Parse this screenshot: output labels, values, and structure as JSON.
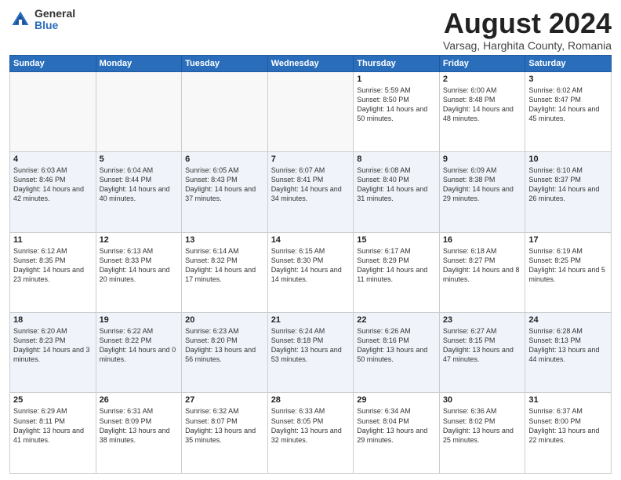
{
  "logo": {
    "general": "General",
    "blue": "Blue"
  },
  "header": {
    "month_year": "August 2024",
    "location": "Varsag, Harghita County, Romania"
  },
  "days_of_week": [
    "Sunday",
    "Monday",
    "Tuesday",
    "Wednesday",
    "Thursday",
    "Friday",
    "Saturday"
  ],
  "weeks": [
    [
      {
        "day": "",
        "info": ""
      },
      {
        "day": "",
        "info": ""
      },
      {
        "day": "",
        "info": ""
      },
      {
        "day": "",
        "info": ""
      },
      {
        "day": "1",
        "info": "Sunrise: 5:59 AM\nSunset: 8:50 PM\nDaylight: 14 hours and 50 minutes."
      },
      {
        "day": "2",
        "info": "Sunrise: 6:00 AM\nSunset: 8:48 PM\nDaylight: 14 hours and 48 minutes."
      },
      {
        "day": "3",
        "info": "Sunrise: 6:02 AM\nSunset: 8:47 PM\nDaylight: 14 hours and 45 minutes."
      }
    ],
    [
      {
        "day": "4",
        "info": "Sunrise: 6:03 AM\nSunset: 8:46 PM\nDaylight: 14 hours and 42 minutes."
      },
      {
        "day": "5",
        "info": "Sunrise: 6:04 AM\nSunset: 8:44 PM\nDaylight: 14 hours and 40 minutes."
      },
      {
        "day": "6",
        "info": "Sunrise: 6:05 AM\nSunset: 8:43 PM\nDaylight: 14 hours and 37 minutes."
      },
      {
        "day": "7",
        "info": "Sunrise: 6:07 AM\nSunset: 8:41 PM\nDaylight: 14 hours and 34 minutes."
      },
      {
        "day": "8",
        "info": "Sunrise: 6:08 AM\nSunset: 8:40 PM\nDaylight: 14 hours and 31 minutes."
      },
      {
        "day": "9",
        "info": "Sunrise: 6:09 AM\nSunset: 8:38 PM\nDaylight: 14 hours and 29 minutes."
      },
      {
        "day": "10",
        "info": "Sunrise: 6:10 AM\nSunset: 8:37 PM\nDaylight: 14 hours and 26 minutes."
      }
    ],
    [
      {
        "day": "11",
        "info": "Sunrise: 6:12 AM\nSunset: 8:35 PM\nDaylight: 14 hours and 23 minutes."
      },
      {
        "day": "12",
        "info": "Sunrise: 6:13 AM\nSunset: 8:33 PM\nDaylight: 14 hours and 20 minutes."
      },
      {
        "day": "13",
        "info": "Sunrise: 6:14 AM\nSunset: 8:32 PM\nDaylight: 14 hours and 17 minutes."
      },
      {
        "day": "14",
        "info": "Sunrise: 6:15 AM\nSunset: 8:30 PM\nDaylight: 14 hours and 14 minutes."
      },
      {
        "day": "15",
        "info": "Sunrise: 6:17 AM\nSunset: 8:29 PM\nDaylight: 14 hours and 11 minutes."
      },
      {
        "day": "16",
        "info": "Sunrise: 6:18 AM\nSunset: 8:27 PM\nDaylight: 14 hours and 8 minutes."
      },
      {
        "day": "17",
        "info": "Sunrise: 6:19 AM\nSunset: 8:25 PM\nDaylight: 14 hours and 5 minutes."
      }
    ],
    [
      {
        "day": "18",
        "info": "Sunrise: 6:20 AM\nSunset: 8:23 PM\nDaylight: 14 hours and 3 minutes."
      },
      {
        "day": "19",
        "info": "Sunrise: 6:22 AM\nSunset: 8:22 PM\nDaylight: 14 hours and 0 minutes."
      },
      {
        "day": "20",
        "info": "Sunrise: 6:23 AM\nSunset: 8:20 PM\nDaylight: 13 hours and 56 minutes."
      },
      {
        "day": "21",
        "info": "Sunrise: 6:24 AM\nSunset: 8:18 PM\nDaylight: 13 hours and 53 minutes."
      },
      {
        "day": "22",
        "info": "Sunrise: 6:26 AM\nSunset: 8:16 PM\nDaylight: 13 hours and 50 minutes."
      },
      {
        "day": "23",
        "info": "Sunrise: 6:27 AM\nSunset: 8:15 PM\nDaylight: 13 hours and 47 minutes."
      },
      {
        "day": "24",
        "info": "Sunrise: 6:28 AM\nSunset: 8:13 PM\nDaylight: 13 hours and 44 minutes."
      }
    ],
    [
      {
        "day": "25",
        "info": "Sunrise: 6:29 AM\nSunset: 8:11 PM\nDaylight: 13 hours and 41 minutes."
      },
      {
        "day": "26",
        "info": "Sunrise: 6:31 AM\nSunset: 8:09 PM\nDaylight: 13 hours and 38 minutes."
      },
      {
        "day": "27",
        "info": "Sunrise: 6:32 AM\nSunset: 8:07 PM\nDaylight: 13 hours and 35 minutes."
      },
      {
        "day": "28",
        "info": "Sunrise: 6:33 AM\nSunset: 8:05 PM\nDaylight: 13 hours and 32 minutes."
      },
      {
        "day": "29",
        "info": "Sunrise: 6:34 AM\nSunset: 8:04 PM\nDaylight: 13 hours and 29 minutes."
      },
      {
        "day": "30",
        "info": "Sunrise: 6:36 AM\nSunset: 8:02 PM\nDaylight: 13 hours and 25 minutes."
      },
      {
        "day": "31",
        "info": "Sunrise: 6:37 AM\nSunset: 8:00 PM\nDaylight: 13 hours and 22 minutes."
      }
    ]
  ]
}
